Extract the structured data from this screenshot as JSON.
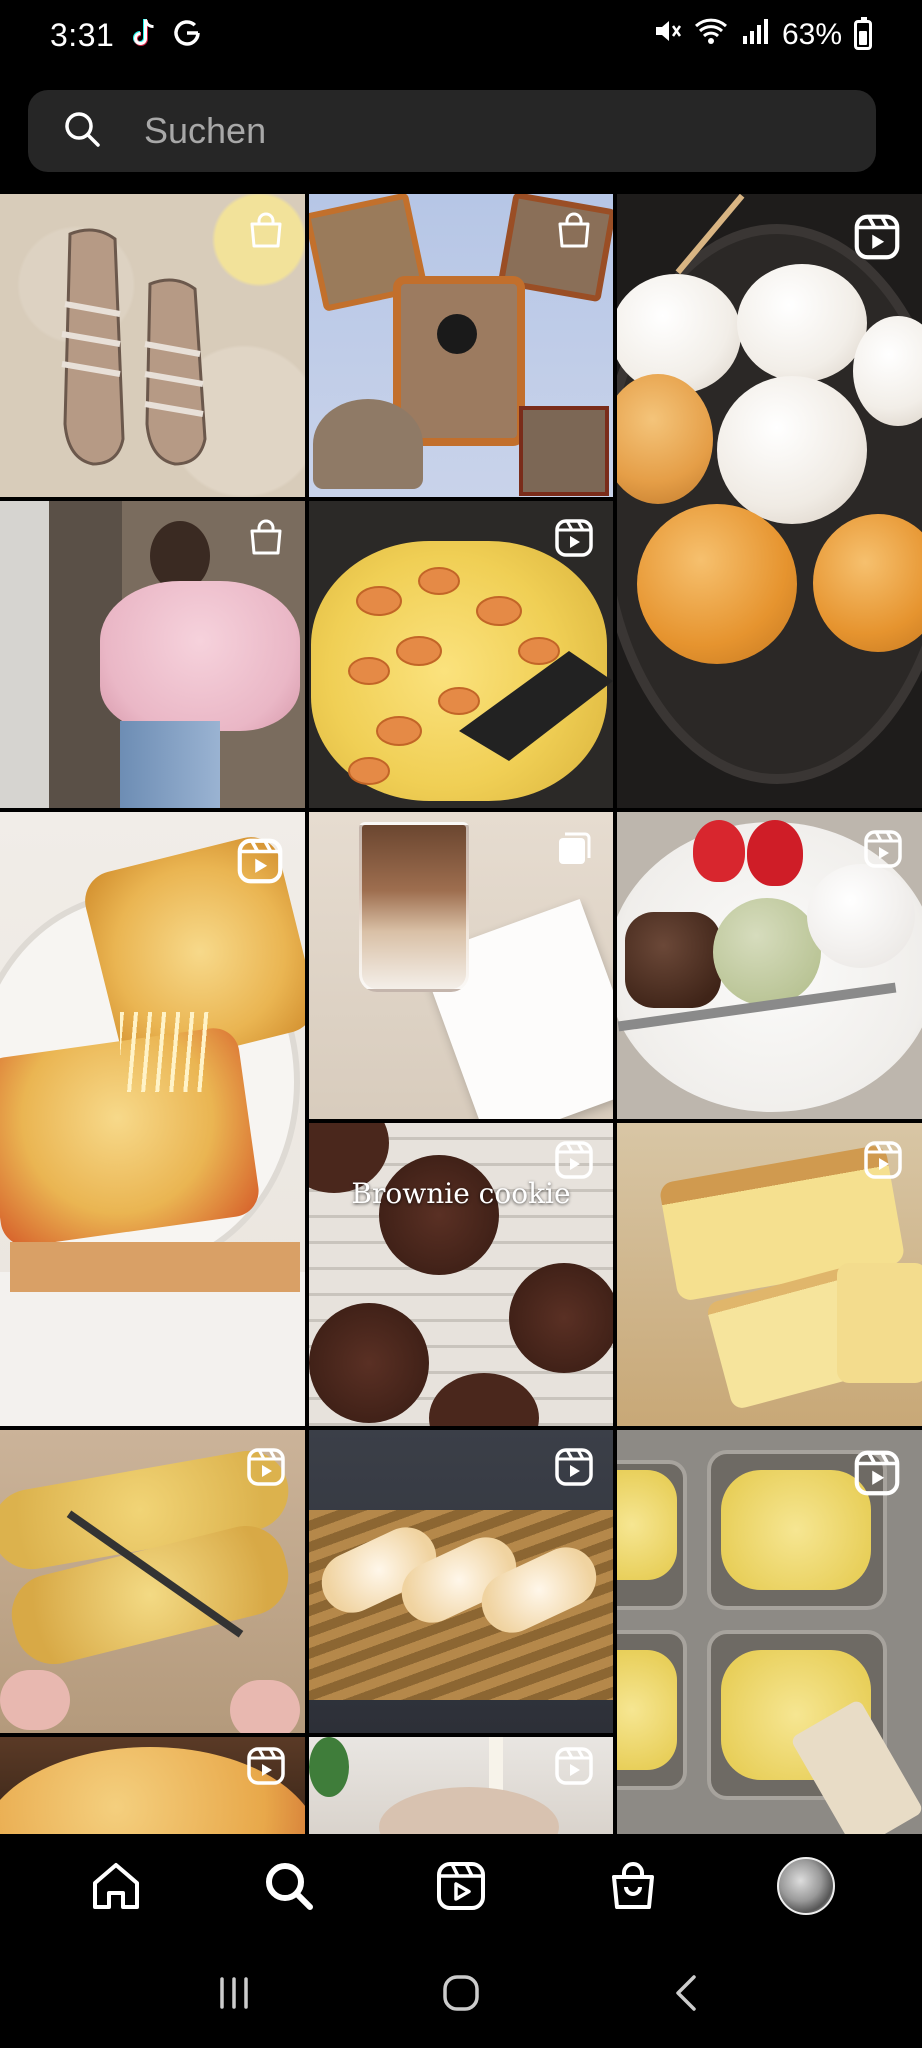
{
  "status_bar": {
    "time": "3:31",
    "battery": "63%"
  },
  "search": {
    "placeholder": "Suchen"
  },
  "grid": {
    "tiles": [
      {
        "name": "tile-sandals",
        "badge": "shopping-bag-icon"
      },
      {
        "name": "tile-mickey-bags",
        "badge": "shopping-bag-icon"
      },
      {
        "name": "tile-buns-pan",
        "badge": "reels-icon"
      },
      {
        "name": "tile-pink-blouse",
        "badge": "shopping-bag-icon"
      },
      {
        "name": "tile-sausage-eggs",
        "badge": "reels-icon"
      },
      {
        "name": "tile-cheese-toast",
        "badge": "reels-icon"
      },
      {
        "name": "tile-iced-latte",
        "badge": "multi-image-icon"
      },
      {
        "name": "tile-daifuku-plate",
        "badge": "reels-icon"
      },
      {
        "name": "tile-brownie-cookie",
        "badge": "reels-icon",
        "caption": "Brownie cookie"
      },
      {
        "name": "tile-sponge-cake",
        "badge": "reels-icon"
      },
      {
        "name": "tile-pastry-cutting",
        "badge": "reels-icon"
      },
      {
        "name": "tile-eclairs",
        "badge": "reels-icon"
      },
      {
        "name": "tile-dough-tray",
        "badge": "reels-icon"
      },
      {
        "name": "tile-pizza",
        "badge": "reels-icon"
      },
      {
        "name": "tile-milk-pour",
        "badge": "reels-icon"
      }
    ]
  },
  "bottom_nav": {
    "items": [
      "home-icon",
      "search-icon",
      "reels-icon",
      "shop-icon",
      "profile-avatar"
    ]
  },
  "system_nav": {
    "items": [
      "recent-apps-icon",
      "home-circle-icon",
      "back-icon"
    ]
  },
  "colors": {
    "background": "#000000",
    "search_bg": "#262626",
    "placeholder": "#a8a8a8"
  }
}
